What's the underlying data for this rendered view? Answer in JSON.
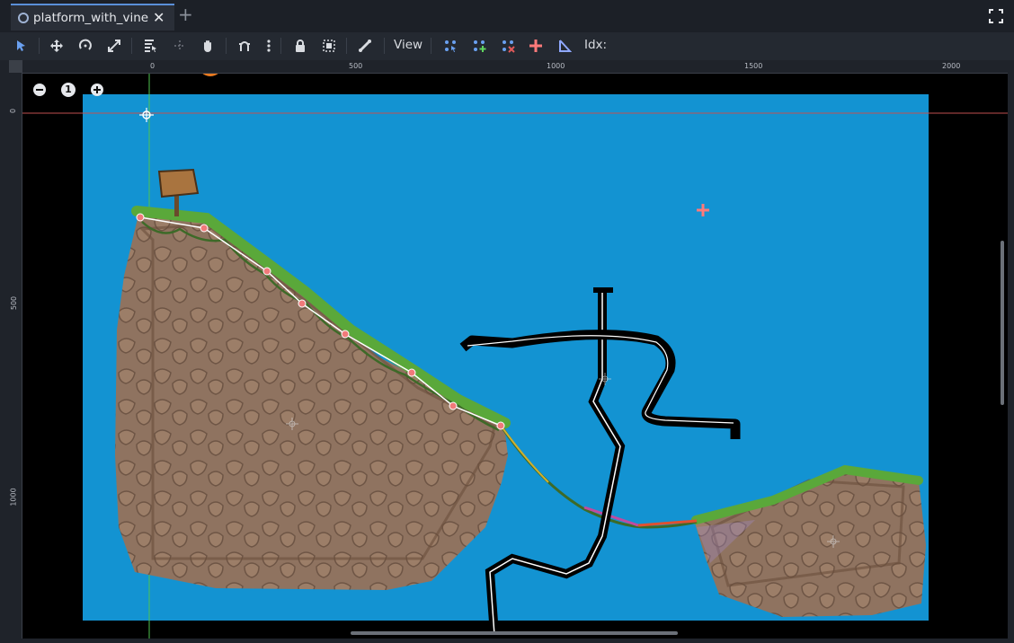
{
  "tab": {
    "title": "platform_with_vine",
    "close_glyph": "✕",
    "add_glyph": "+"
  },
  "toolbar": {
    "view_label": "View",
    "idx_label": "Idx:",
    "icons": [
      "select-icon",
      "move-icon",
      "rotate-icon",
      "scale-icon",
      "list-select-icon",
      "pivot-icon",
      "pan-icon",
      "snap-icon",
      "more-icon",
      "lock-icon",
      "group-icon",
      "bone-icon",
      "select-points-icon",
      "add-point-icon",
      "delete-point-icon",
      "center-icon",
      "close-curve-icon"
    ]
  },
  "rulers": {
    "top": [
      "0",
      "500",
      "1000",
      "1500",
      "2000"
    ],
    "left": [
      "0",
      "500",
      "1000"
    ]
  },
  "zoom": {
    "reset_label": "1"
  },
  "colors": {
    "accent": "#5a8fd8",
    "sky": "#1393d2",
    "grass": "#5aa83a",
    "rock": "#9a7a62",
    "guide_red": "#c05050",
    "guide_green": "#4fc34f"
  }
}
